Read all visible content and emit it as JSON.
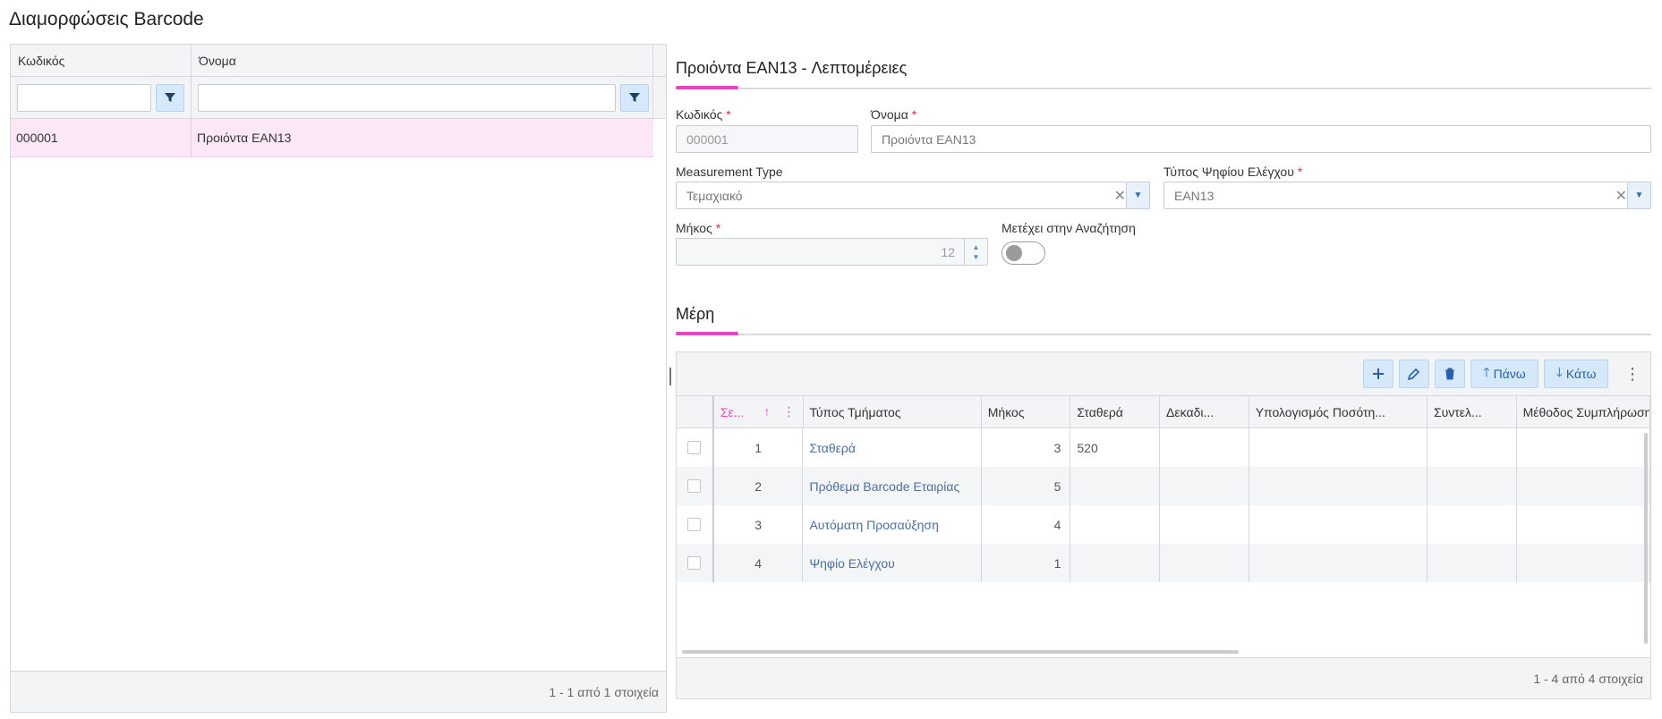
{
  "page": {
    "title": "Διαμορφώσεις Barcode"
  },
  "list": {
    "headers": {
      "code": "Κωδικός",
      "name": "Όνομα"
    },
    "rows": [
      {
        "code": "000001",
        "name": "Προιόντα EAN13"
      }
    ],
    "footer": "1 - 1 από 1 στοιχεία"
  },
  "details": {
    "title": "Προιόντα EAN13 - Λεπτομέρειες",
    "code": {
      "label": "Κωδικός",
      "value": "000001"
    },
    "name": {
      "label": "Όνομα",
      "value": "Προιόντα EAN13"
    },
    "measurement_type": {
      "label": "Measurement Type",
      "value": "Τεμαχιακό"
    },
    "check_digit_type": {
      "label": "Τύπος Ψηφίου Ελέγχου",
      "value": "EAN13"
    },
    "length": {
      "label": "Μήκος",
      "value": "12"
    },
    "search": {
      "label": "Μετέχει στην Αναζήτηση",
      "enabled": false
    },
    "required_mark": "*"
  },
  "parts": {
    "title": "Μέρη",
    "toolbar": {
      "up_label": "Πάνω",
      "down_label": "Κάτω"
    },
    "headers": {
      "seq": "Σε...",
      "type": "Τύπος Τμήματος",
      "length": "Μήκος",
      "constant": "Σταθερά",
      "decimals": "Δεκαδι...",
      "calc": "Υπολογισμός Ποσότη...",
      "coef": "Συντελ...",
      "fill": "Μέθοδος Συμπλήρωσης"
    },
    "rows": [
      {
        "seq": "1",
        "type": "Σταθερά",
        "length": "3",
        "constant": "520"
      },
      {
        "seq": "2",
        "type": "Πρόθεμα Barcode Εταιρίας",
        "length": "5",
        "constant": ""
      },
      {
        "seq": "3",
        "type": "Αυτόματη Προσαύξηση",
        "length": "4",
        "constant": ""
      },
      {
        "seq": "4",
        "type": "Ψηφίο Ελέγχου",
        "length": "1",
        "constant": ""
      }
    ],
    "footer": "1 - 4 από 4 στοιχεία"
  },
  "colors": {
    "accent": "#e547bd",
    "selected_row": "#fbe7f5",
    "button_bg": "#d6e9fb"
  }
}
